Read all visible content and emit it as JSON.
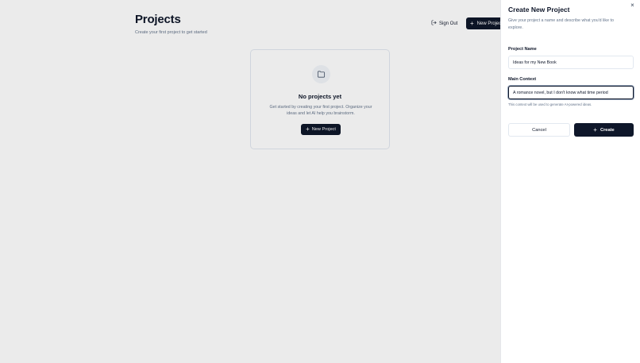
{
  "page": {
    "title": "Projects",
    "subtitle": "Create your first project to get started",
    "sign_out_label": "Sign Out",
    "new_project_label": "New Project"
  },
  "empty_state": {
    "icon": "folder-icon",
    "title": "No projects yet",
    "description": "Get started by creating your first project. Organize your ideas and let AI help you brainstorm.",
    "button_label": "New Project"
  },
  "drawer": {
    "title": "Create New Project",
    "description": "Give your project a name and describe what you'd like to explore.",
    "close_icon": "×",
    "project_name": {
      "label": "Project Name",
      "value": "Ideas for my New Book"
    },
    "main_context": {
      "label": "Main Context",
      "value": "A romance novel, but I don't know what time period",
      "helper": "This context will be used to generate AI-powered ideas."
    },
    "cancel_label": "Cancel",
    "create_label": "Create"
  },
  "colors": {
    "primary": "#0f172a",
    "muted_text": "#64748b",
    "border": "#e2e8f0",
    "icon_bg": "#f1f5f9"
  }
}
